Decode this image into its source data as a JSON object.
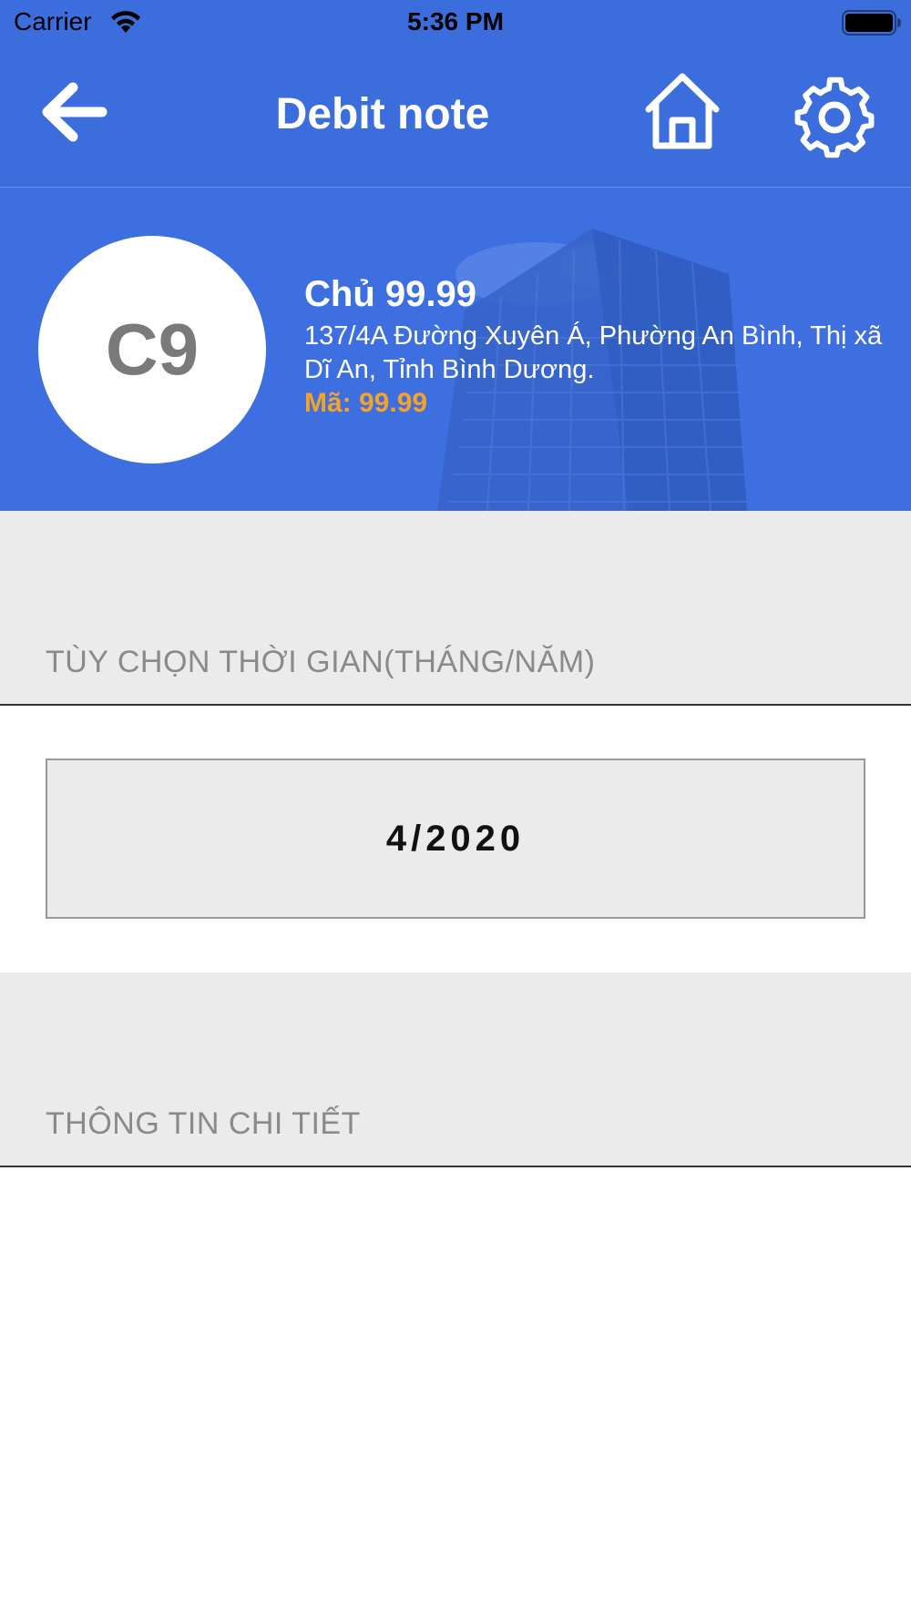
{
  "status_bar": {
    "carrier": "Carrier",
    "time": "5:36 PM",
    "wifi_icon": "wifi-icon",
    "battery_icon": "battery-icon"
  },
  "nav": {
    "title": "Debit note",
    "back_icon": "arrow-left-icon",
    "home_icon": "home-icon",
    "settings_icon": "gear-icon"
  },
  "profile": {
    "avatar_text": "C9",
    "name": "Chủ 99.99",
    "address": "137/4A Đường Xuyên Á, Phường An Bình, Thị xã Dĩ An, Tỉnh Bình Dương.",
    "code": "Mã: 99.99"
  },
  "sections": {
    "time_label": "TÙY CHỌN THỜI GIAN(THÁNG/NĂM)",
    "detail_label": "THÔNG TIN CHI TIẾT"
  },
  "date_picker": {
    "value": "4/2020"
  },
  "colors": {
    "primary": "#3b6ddc",
    "code_accent": "#f3a22a",
    "section_bg": "#ebebeb",
    "section_text": "#8a8a8a"
  }
}
